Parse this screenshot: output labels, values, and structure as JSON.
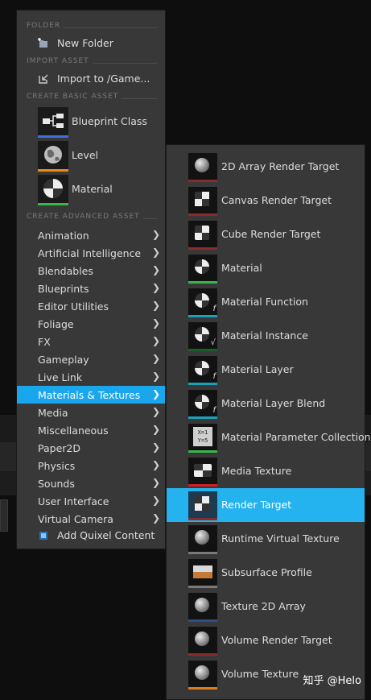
{
  "menu": {
    "sections": {
      "folder": "FOLDER",
      "import": "IMPORT ASSET",
      "basic": "CREATE BASIC ASSET",
      "advanced": "CREATE ADVANCED ASSET"
    },
    "new_folder": "New Folder",
    "import_to": "Import to /Game...",
    "basic_assets": [
      {
        "label": "Blueprint Class",
        "color": "#3d6fe0"
      },
      {
        "label": "Level",
        "color": "#f08a17"
      },
      {
        "label": "Material",
        "color": "#39b54a"
      }
    ],
    "advanced_items": [
      "Animation",
      "Artificial Intelligence",
      "Blendables",
      "Blueprints",
      "Editor Utilities",
      "Foliage",
      "FX",
      "Gameplay",
      "Live Link",
      "Materials & Textures",
      "Media",
      "Miscellaneous",
      "Paper2D",
      "Physics",
      "Sounds",
      "User Interface",
      "Virtual Camera"
    ],
    "active_item": "Materials & Textures",
    "quixel": "Add Quixel Content"
  },
  "submenu": {
    "items": [
      {
        "label": "2D Array Render Target",
        "icon": "cube-icon",
        "color": "#8b2c2c"
      },
      {
        "label": "Canvas Render Target",
        "icon": "canvas-icon",
        "color": "#8b2c2c"
      },
      {
        "label": "Cube Render Target",
        "icon": "cube-checker-icon",
        "color": "#8b2c2c"
      },
      {
        "label": "Material",
        "icon": "material-sphere-icon",
        "color": "#39b54a"
      },
      {
        "label": "Material Function",
        "icon": "material-function-icon",
        "color": "#1ba0b8"
      },
      {
        "label": "Material Instance",
        "icon": "material-instance-icon",
        "color": "#1a5c2a"
      },
      {
        "label": "Material Layer",
        "icon": "material-layer-icon",
        "color": "#1ba0b8"
      },
      {
        "label": "Material Layer Blend",
        "icon": "material-layer-blend-icon",
        "color": "#1ba0b8"
      },
      {
        "label": "Material Parameter Collection",
        "icon": "parameter-collection-icon",
        "color": "#39b54a"
      },
      {
        "label": "Media Texture",
        "icon": "media-texture-icon",
        "color": "#d21e1e"
      },
      {
        "label": "Render Target",
        "icon": "render-target-icon",
        "color": "#8b2c2c"
      },
      {
        "label": "Runtime Virtual Texture",
        "icon": "virtual-texture-icon",
        "color": "#7a7a7a"
      },
      {
        "label": "Subsurface Profile",
        "icon": "subsurface-icon",
        "color": "#7a7a7a"
      },
      {
        "label": "Texture 2D Array",
        "icon": "cube-icon",
        "color": "#2d4f8a"
      },
      {
        "label": "Volume Render Target",
        "icon": "cube-icon",
        "color": "#8b2c2c"
      },
      {
        "label": "Volume Texture",
        "icon": "cube-icon",
        "color": "#e07a1a"
      }
    ],
    "active_item": "Render Target",
    "x_formula": "X=1\nY=5"
  },
  "watermark": "知乎 @Helo"
}
